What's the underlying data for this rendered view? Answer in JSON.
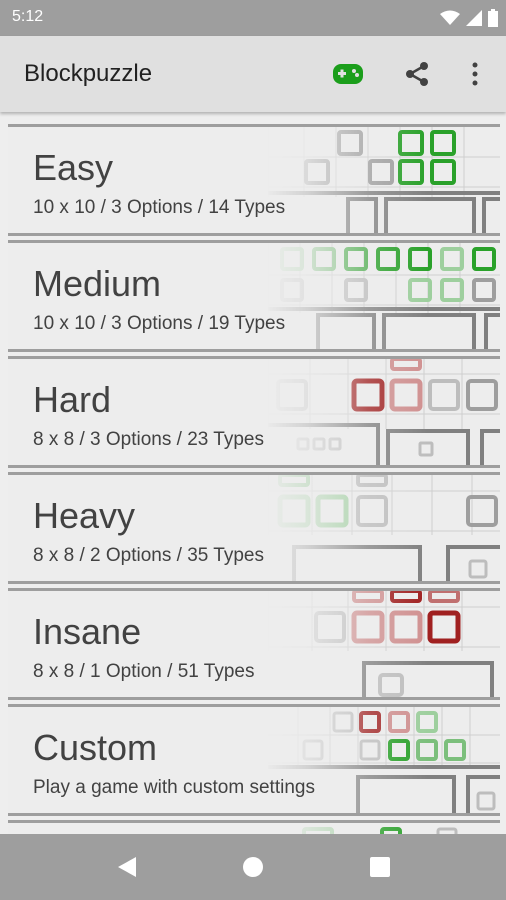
{
  "status_bar": {
    "time": "5:12",
    "icons": [
      "wifi-icon",
      "signal-icon",
      "battery-icon"
    ]
  },
  "app_bar": {
    "title": "Blockpuzzle",
    "actions": [
      "gamepad-icon",
      "share-icon",
      "more-vert-icon"
    ],
    "accent": "#1b9e1b"
  },
  "levels": [
    {
      "name": "Easy",
      "description": "10 x 10 / 3 Options / 14 Types"
    },
    {
      "name": "Medium",
      "description": "10 x 10 / 3 Options / 19 Types"
    },
    {
      "name": "Hard",
      "description": "8 x 8 / 3 Options / 23 Types"
    },
    {
      "name": "Heavy",
      "description": "8 x 8 / 2 Options / 35 Types"
    },
    {
      "name": "Insane",
      "description": "8 x 8 / 1 Option / 51 Types"
    },
    {
      "name": "Custom",
      "description": "Play a game with custom settings"
    }
  ],
  "colors": {
    "green": "#2aa12a",
    "red": "#a02020",
    "gray": "#9e9e9e"
  },
  "nav_bar": [
    "back-icon",
    "home-icon",
    "recents-icon"
  ]
}
